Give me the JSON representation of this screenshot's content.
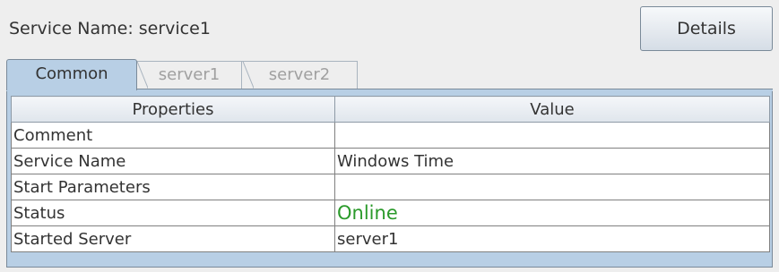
{
  "header": {
    "service_name_text": "Service Name: service1",
    "details_label": "Details"
  },
  "tabs": [
    {
      "label": "Common",
      "selected": true
    },
    {
      "label": "server1",
      "selected": false
    },
    {
      "label": "server2",
      "selected": false
    }
  ],
  "table": {
    "columns": [
      "Properties",
      "Value"
    ],
    "rows": [
      {
        "property": "Comment",
        "value": ""
      },
      {
        "property": "Service Name",
        "value": "Windows Time"
      },
      {
        "property": "Start Parameters",
        "value": ""
      },
      {
        "property": "Status",
        "value": "Online"
      },
      {
        "property": "Started Server",
        "value": "server1"
      }
    ]
  },
  "colors": {
    "tab_selected": "#b8cfe5",
    "status_online": "#2a9a2a",
    "background": "#eeeeee"
  }
}
